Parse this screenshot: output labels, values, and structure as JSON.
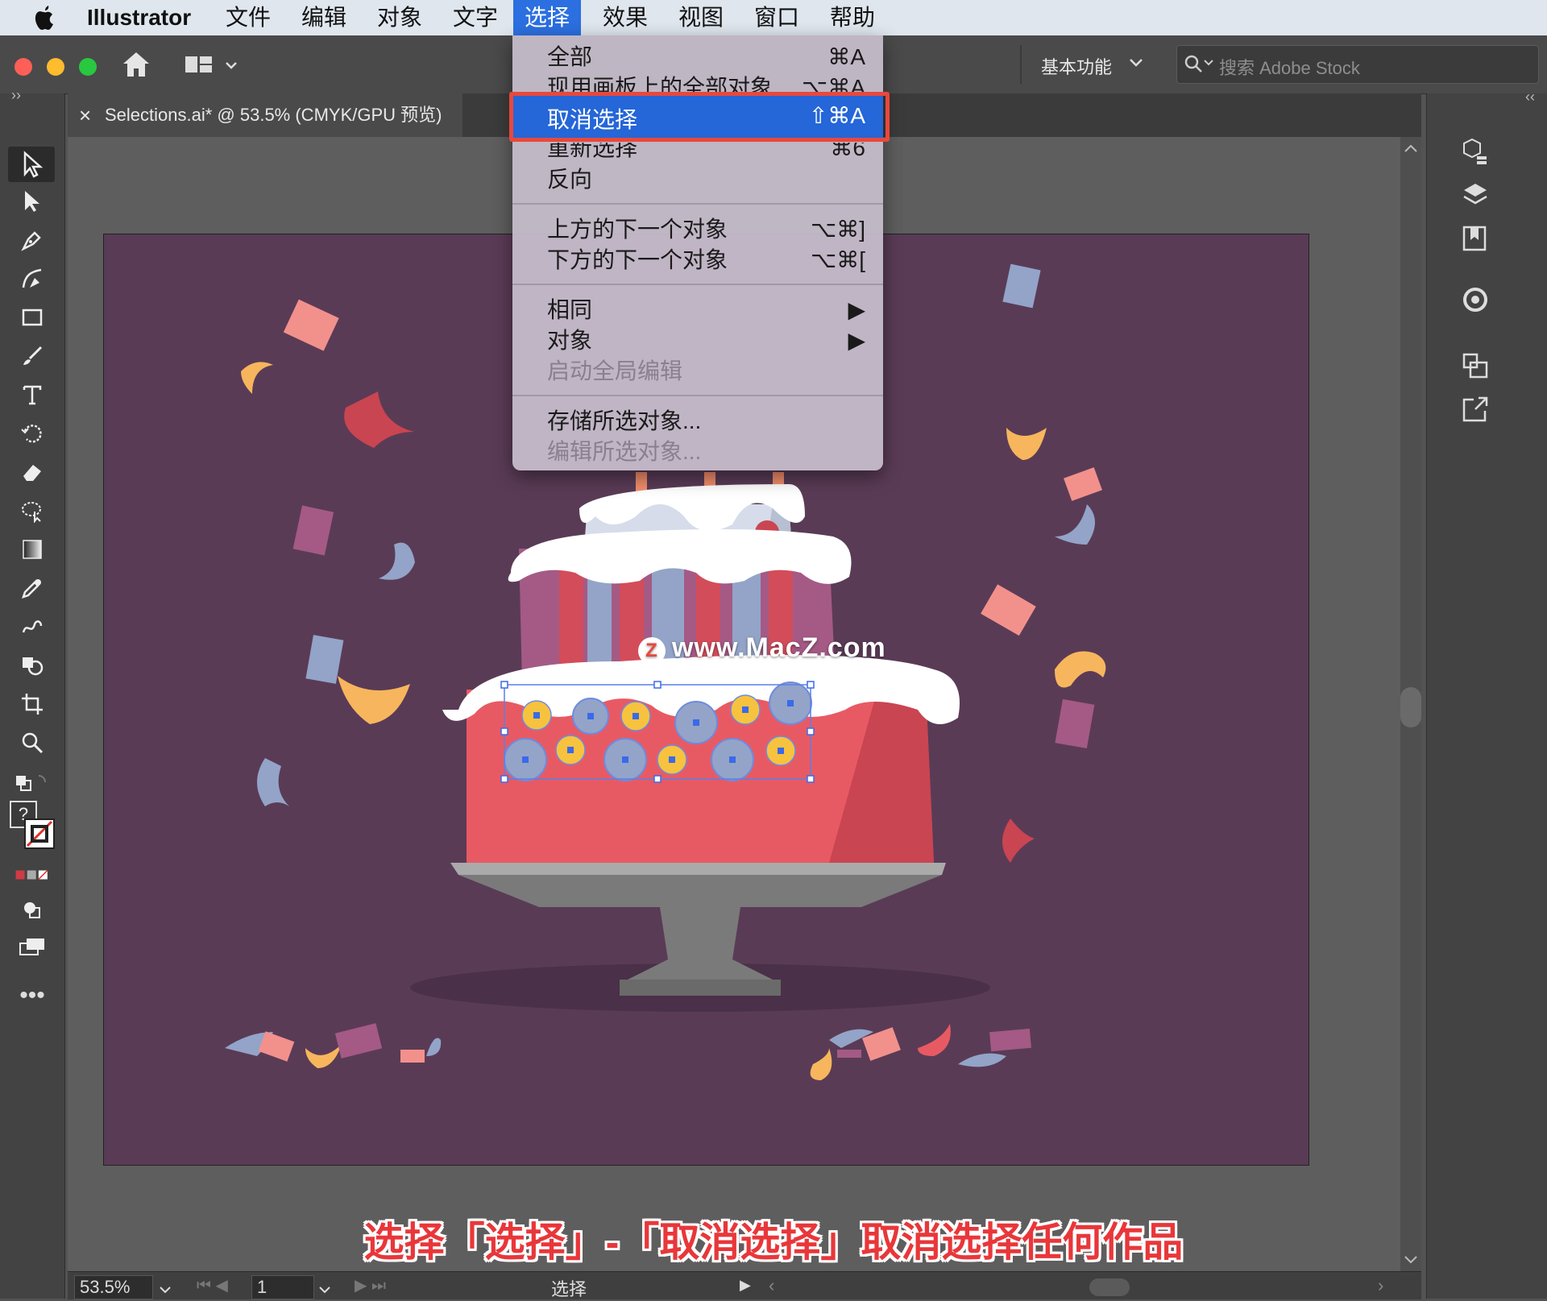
{
  "menubar": {
    "apple": "",
    "app": "Illustrator",
    "items": [
      "文件",
      "编辑",
      "对象",
      "文字",
      "选择",
      "效果",
      "视图",
      "窗口",
      "帮助"
    ],
    "active_index": 4
  },
  "toolbar": {
    "workspace": "基本功能",
    "search_placeholder": "搜索 Adobe Stock"
  },
  "document": {
    "tab_close": "×",
    "tab_title": "Selections.ai* @ 53.5% (CMYK/GPU 预览)"
  },
  "select_menu": {
    "items": [
      {
        "label": "全部",
        "shortcut": "⌘A",
        "disabled": false
      },
      {
        "label": "现用画板上的全部对象",
        "shortcut": "⌥⌘A",
        "disabled": false
      },
      {
        "label": "取消选择",
        "shortcut": "⇧⌘A",
        "disabled": false,
        "highlighted": true
      },
      {
        "label": "重新选择",
        "shortcut": "⌘6",
        "disabled": false
      },
      {
        "label": "反向",
        "shortcut": "",
        "disabled": false
      },
      {
        "label": "上方的下一个对象",
        "shortcut": "⌥⌘]",
        "disabled": false
      },
      {
        "label": "下方的下一个对象",
        "shortcut": "⌥⌘[",
        "disabled": false
      },
      {
        "label": "相同",
        "shortcut": "▶",
        "disabled": false
      },
      {
        "label": "对象",
        "shortcut": "▶",
        "disabled": false
      },
      {
        "label": "启动全局编辑",
        "shortcut": "",
        "disabled": true
      },
      {
        "label": "存储所选对象...",
        "shortcut": "",
        "disabled": false
      },
      {
        "label": "编辑所选对象...",
        "shortcut": "",
        "disabled": true
      }
    ]
  },
  "status": {
    "zoom": "53.5%",
    "artboard": "1",
    "mode": "选择"
  },
  "watermark": "www.MacZ.com",
  "caption": "选择「选择」-「取消选择」取消选择任何作品",
  "colors": {
    "artboard": "#5a3b56",
    "highlight": "#2566d8",
    "callout": "#e8483c",
    "caption": "#e8373a"
  }
}
